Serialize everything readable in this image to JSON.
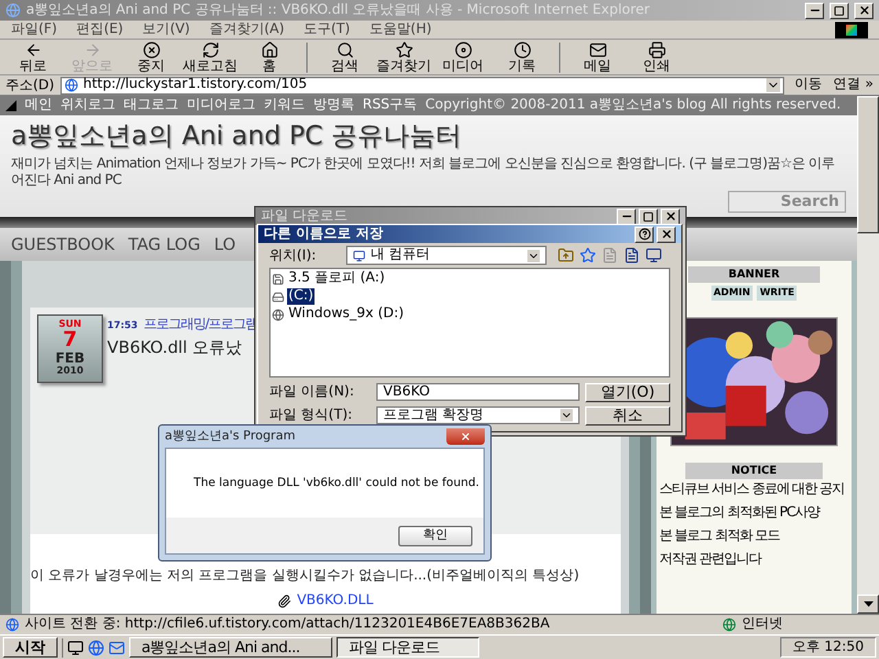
{
  "window": {
    "title": "a뽕잎소년a의 Ani and PC 공유나눔터 :: VB6KO.dll 오류났을때 사용 - Microsoft Internet Explorer"
  },
  "menu": [
    "파일(F)",
    "편집(E)",
    "보기(V)",
    "즐겨찾기(A)",
    "도구(T)",
    "도움말(H)"
  ],
  "toolbar": [
    {
      "label": "뒤로",
      "disabled": false
    },
    {
      "label": "앞으로",
      "disabled": true
    },
    {
      "label": "중지",
      "disabled": false
    },
    {
      "label": "새로고침",
      "disabled": false
    },
    {
      "label": "홈",
      "disabled": false
    },
    {
      "label": "검색",
      "disabled": false
    },
    {
      "label": "즐겨찾기",
      "disabled": false
    },
    {
      "label": "미디어",
      "disabled": false
    },
    {
      "label": "기록",
      "disabled": false
    },
    {
      "label": "메일",
      "disabled": false
    },
    {
      "label": "인쇄",
      "disabled": false
    }
  ],
  "address": {
    "label": "주소(D)",
    "url": "http://luckystar1.tistory.com/105",
    "go": "이동",
    "links": "연결 »"
  },
  "blog": {
    "nav": [
      "메인",
      "위치로그",
      "태그로그",
      "미디어로그",
      "키워드",
      "방명록",
      "RSS구독"
    ],
    "copyright": "Copyright© 2008-2011 a뽕잎소년a's blog All rights reserved.",
    "title": "a뽕잎소년a의 Ani and PC 공유나눔터",
    "subtitle": "재미가 넘치는 Animation 언제나 정보가 가득~ PC가 한곳에 모였다!! 저희 블로그에 오신분을 진심으로 환영합니다. (구 블로그명)꿈☆은 이루어진다 Ani and PC",
    "search": {
      "placeholder": "Search"
    },
    "tabs": [
      "GUESTBOOK",
      "TAG LOG",
      "LO"
    ]
  },
  "post": {
    "date": {
      "weekday": "SUN",
      "day": "7",
      "month": "FEB",
      "year": "2010"
    },
    "time": "17:53",
    "category": "프로그래밍/프로그램",
    "title": "VB6KO.dll 오류났",
    "body": "이 오류가 날경우에는 저의 프로그램을 실행시킬수가 없습니다...(비주얼베이직의 특성상)",
    "attachment": "VB6KO.DLL"
  },
  "sidebar": {
    "banner": {
      "heading": "BANNER",
      "buttons": [
        "ADMIN",
        "WRITE"
      ]
    },
    "notice": {
      "heading": "NOTICE",
      "items": [
        "스티큐브 서비스 종료에 대한 공지",
        "본 블로그의 최적화된 PC사양",
        "본 블로그 최적화 모드",
        "저작권 관련입니다"
      ]
    }
  },
  "status_bar": {
    "text": "사이트 전환 중: http://cfile6.uf.tistory.com/attach/1123201E4B6E7EA8B362BA",
    "zone": "인터넷"
  },
  "taskbar": {
    "start": "시작",
    "tasks": [
      {
        "label": "a뽕잎소년a의 Ani and...",
        "selected": false
      },
      {
        "label": "파일 다운로드",
        "selected": true
      }
    ],
    "clock": "오후 12:50"
  },
  "download_dialog": {
    "title": "파일 다운로드"
  },
  "save_dialog": {
    "title": "다른 이름으로 저장",
    "location_label": "위치(I):",
    "location": "내 컴퓨터",
    "items": [
      {
        "label": "3.5 플로피 (A:)",
        "selected": false
      },
      {
        "label": "(C:)",
        "selected": true
      },
      {
        "label": "Windows_9x (D:)",
        "selected": false
      }
    ],
    "filename_label": "파일 이름(N):",
    "filename": "VB6KO",
    "type_label": "파일 형식(T):",
    "type": "프로그램 확장명",
    "buttons": [
      "열기(O)",
      "취소"
    ]
  },
  "error_dialog": {
    "title": "a뽕잎소년a's Program",
    "message": "The language DLL 'vb6ko.dll' could not be found.",
    "button": "확인"
  }
}
